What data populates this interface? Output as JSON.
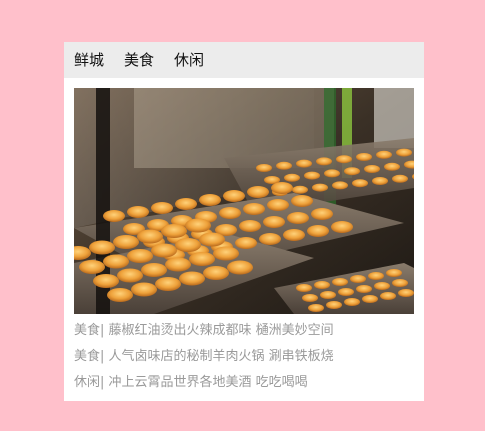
{
  "tabs": [
    {
      "label": "鲜城"
    },
    {
      "label": "美食"
    },
    {
      "label": "休闲"
    }
  ],
  "news": [
    {
      "category": "美食|",
      "title": "藤椒红油烫出火辣成都味 樋洲美妙空间"
    },
    {
      "category": "美食|",
      "title": "人气卤味店的秘制羊肉火锅 涮串铁板烧"
    },
    {
      "category": "休闲|",
      "title": "冲上云霄品世界各地美酒 吃吃喝喝"
    }
  ],
  "colors": {
    "page_bg": "#ffc0cb",
    "tab_bar_bg": "#ececec",
    "news_text": "#9a9a9a"
  }
}
